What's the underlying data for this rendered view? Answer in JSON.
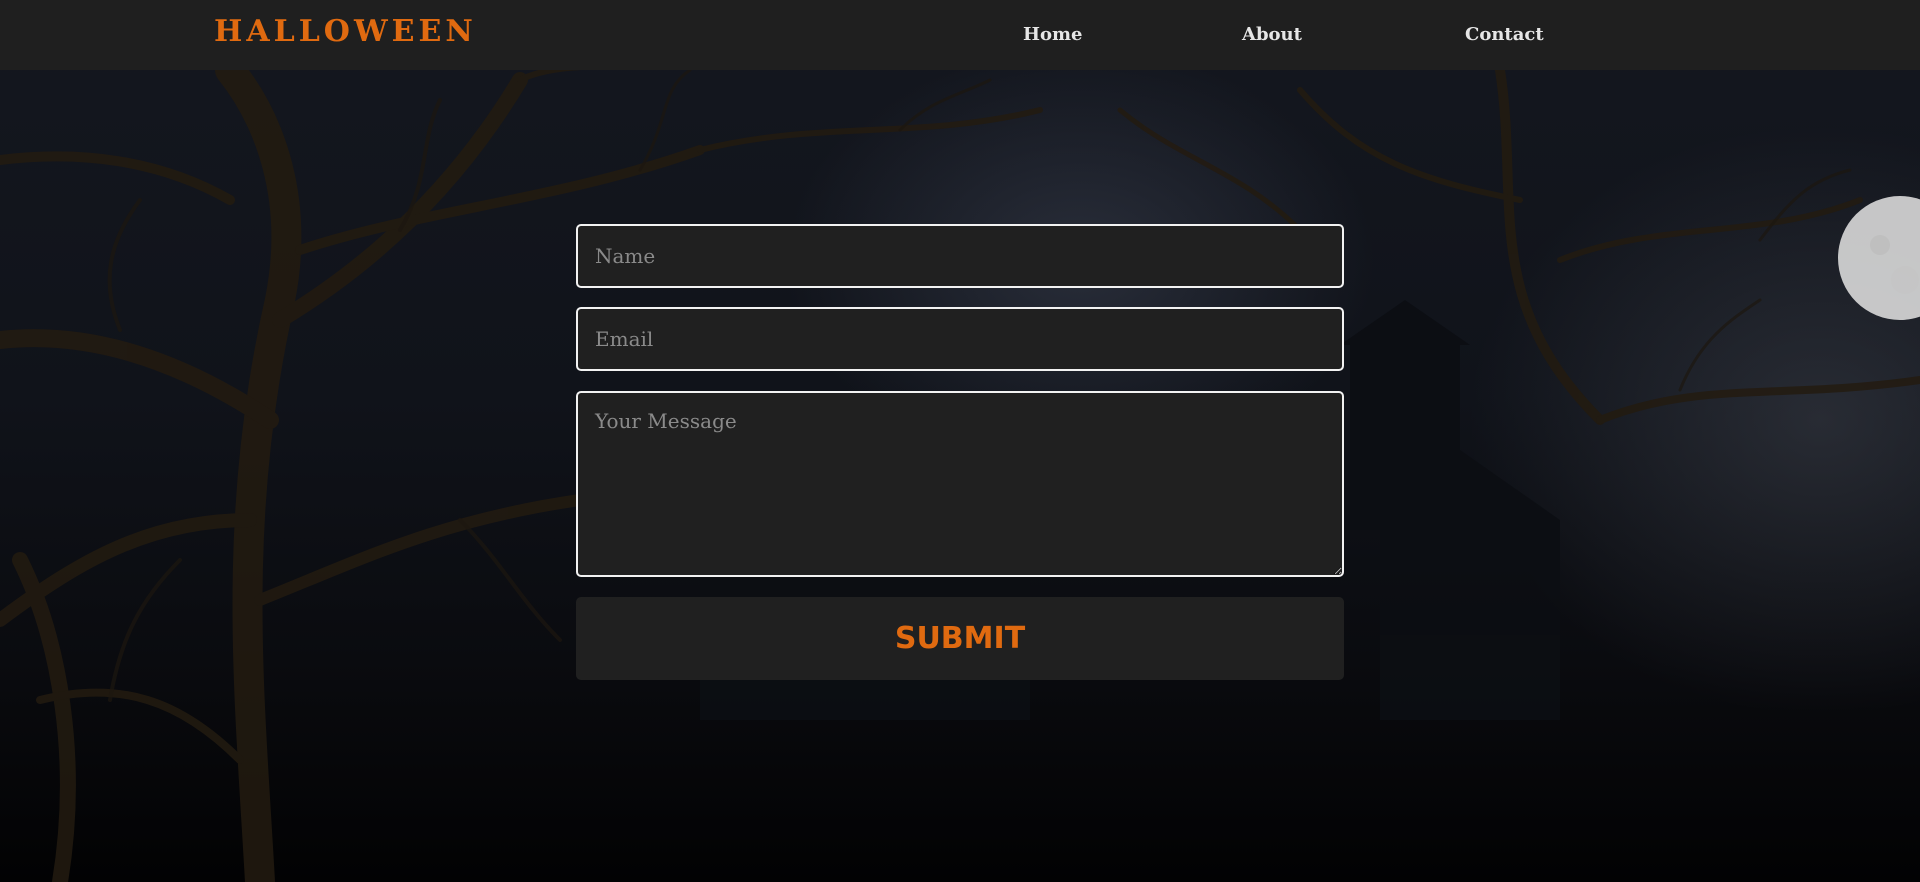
{
  "navbar": {
    "brand": "HALLOWEEN",
    "links": [
      {
        "label": "Home"
      },
      {
        "label": "About"
      },
      {
        "label": "Contact"
      }
    ]
  },
  "form": {
    "name_placeholder": "Name",
    "email_placeholder": "Email",
    "message_placeholder": "Your Message",
    "submit_label": "SUBMIT"
  },
  "colors": {
    "accent": "#e06a10",
    "navbar_bg": "#1f1f1f",
    "field_bg": "#202020",
    "field_border": "#f2f2f2",
    "nav_text": "#e6e6e6"
  }
}
